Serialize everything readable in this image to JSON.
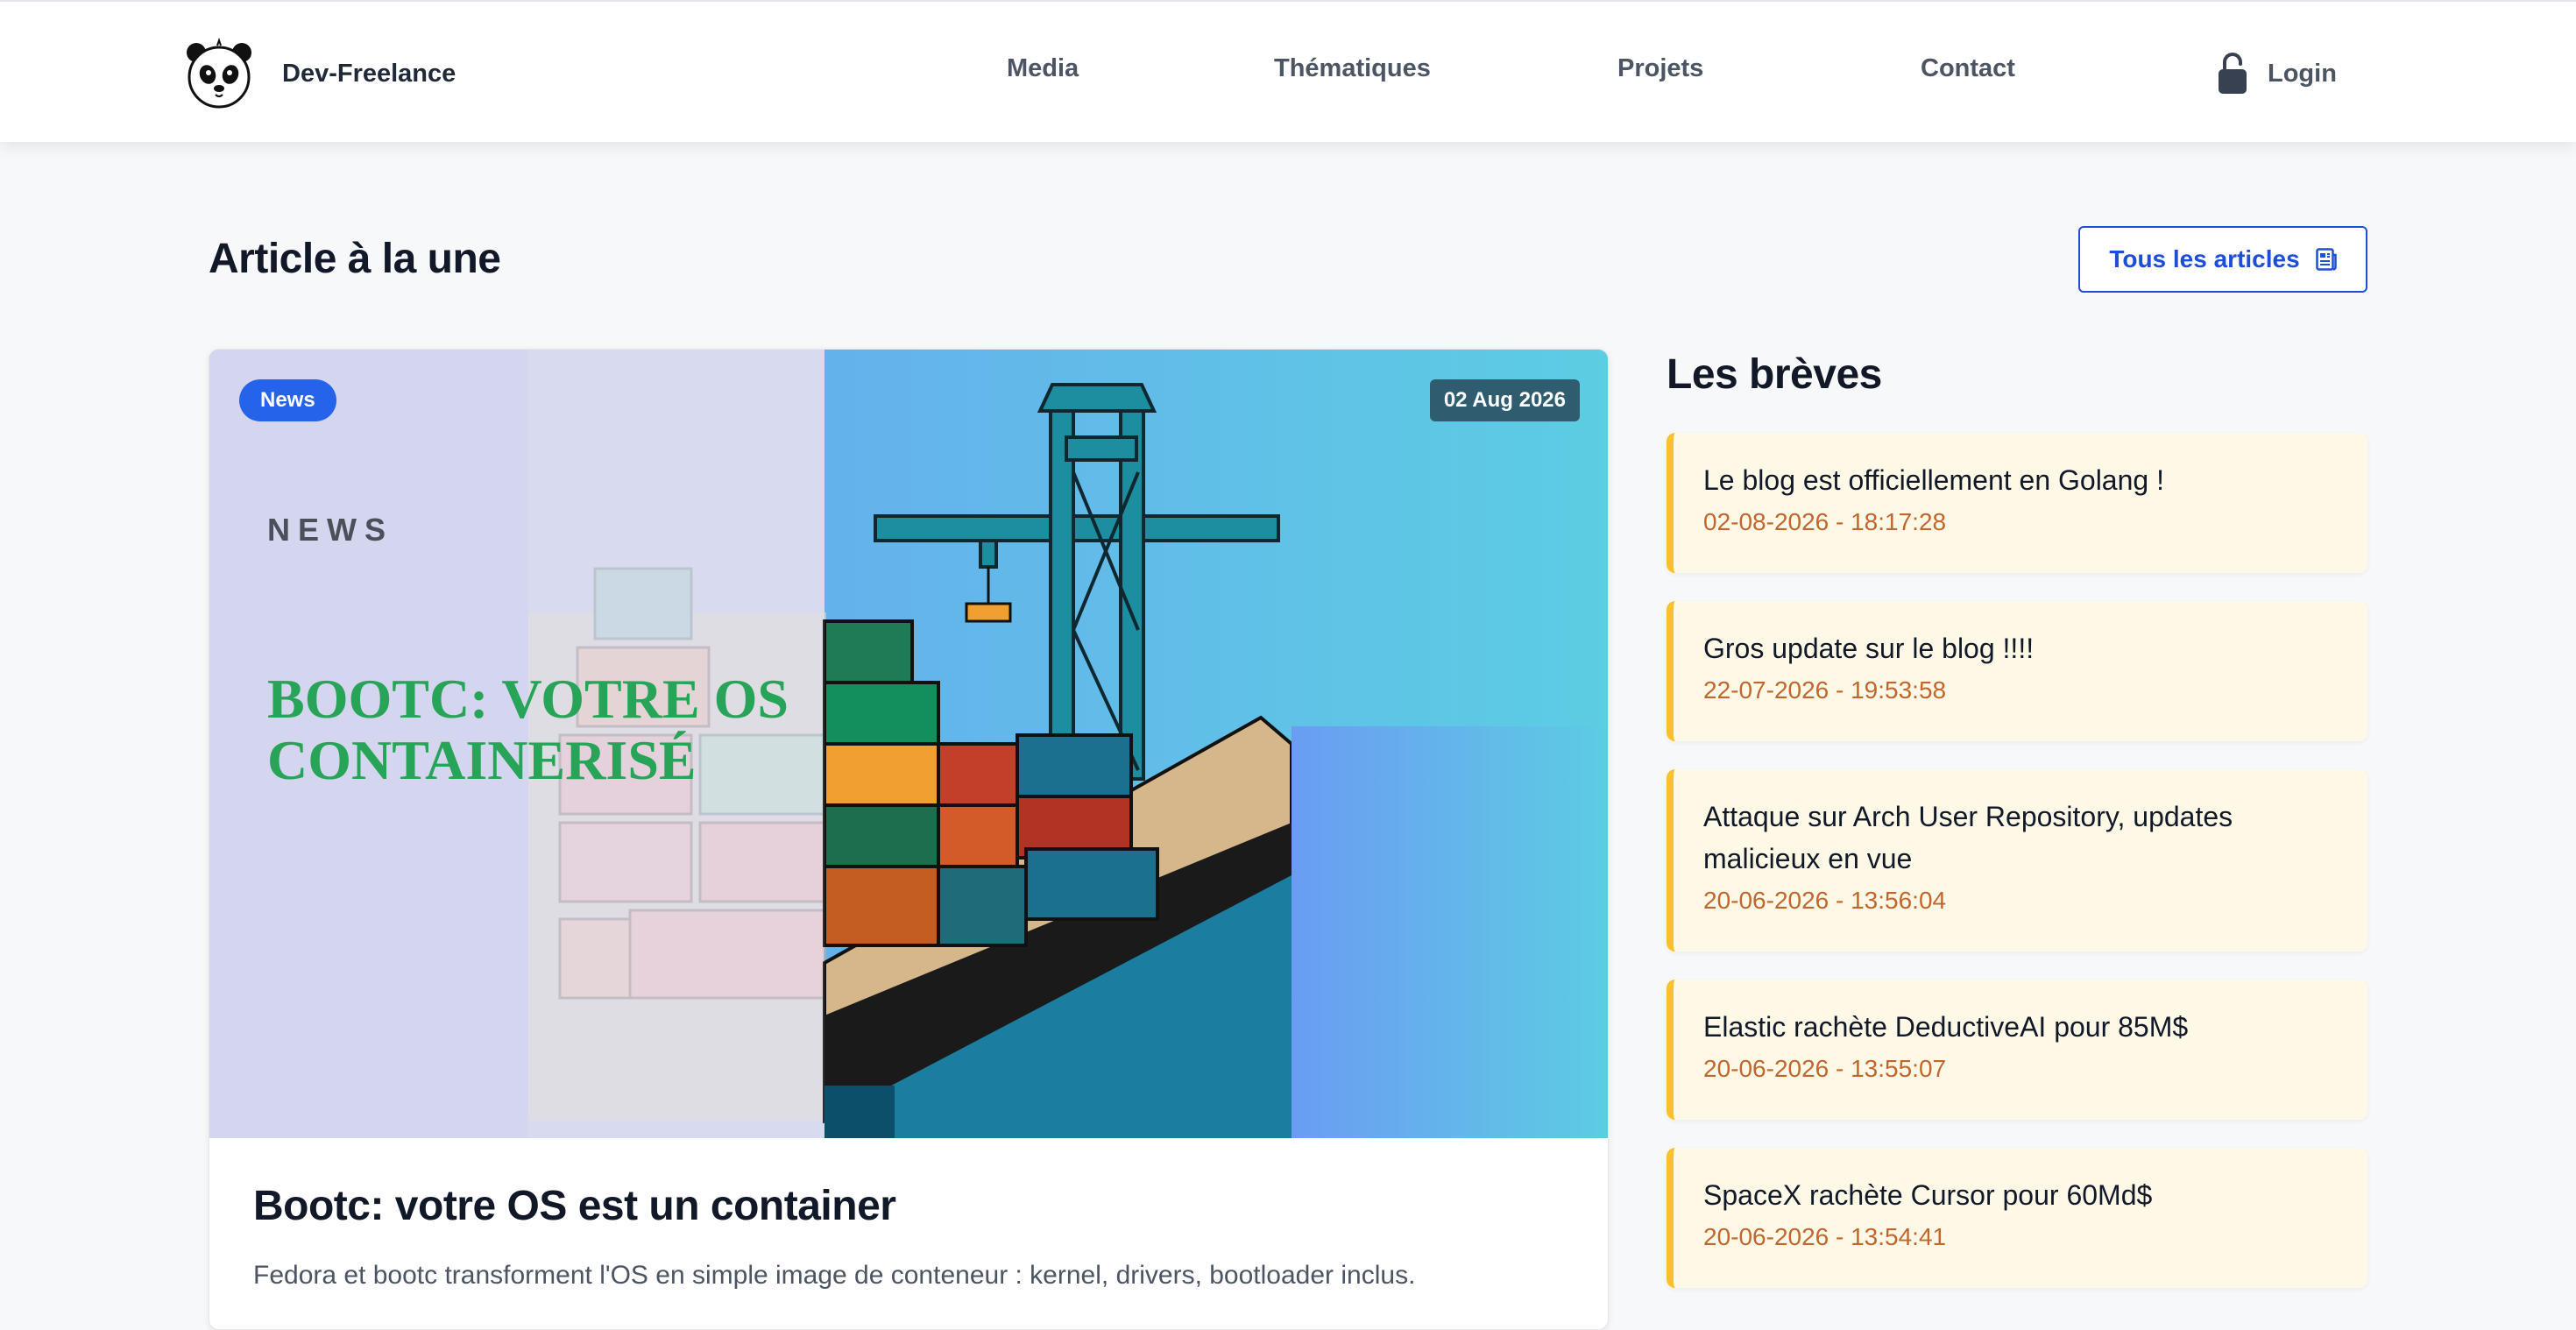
{
  "header": {
    "brand_name": "Dev-Freelance",
    "nav": [
      {
        "label": "Media"
      },
      {
        "label": "Thématiques"
      },
      {
        "label": "Projets"
      },
      {
        "label": "Contact"
      }
    ],
    "login_label": "Login",
    "icons": {
      "logo": "panda-logo",
      "login": "unlock-icon"
    }
  },
  "featured": {
    "section_title": "Article à la une",
    "all_articles_label": "Tous les articles",
    "all_articles_icon": "newspaper-icon",
    "category": "News",
    "date": "02 Aug 2026",
    "image_kicker": "NEWS",
    "image_headline_line1": "BOOTC: VOTRE OS",
    "image_headline_line2": "CONTAINERISÉ",
    "title": "Bootc: votre OS est un container",
    "excerpt": "Fedora et bootc transforment l'OS en simple image de conteneur : kernel, drivers, bootloader inclus."
  },
  "breves": {
    "title": "Les brèves",
    "items": [
      {
        "title": "Le blog est officiellement en Golang !",
        "date": "02-08-2026 - 18:17:28"
      },
      {
        "title": "Gros update sur le blog !!!!",
        "date": "22-07-2026 - 19:53:58"
      },
      {
        "title": "Attaque sur Arch User Repository, updates malicieux en vue",
        "date": "20-06-2026 - 13:56:04"
      },
      {
        "title": "Elastic rachète DeductiveAI pour 85M$",
        "date": "20-06-2026 - 13:55:07"
      },
      {
        "title": "SpaceX rachète Cursor pour 60Md$",
        "date": "20-06-2026 - 13:54:41"
      }
    ]
  },
  "colors": {
    "accent": "#1d4ed8",
    "badge": "#2563eb",
    "breve_bg": "#fef9e7",
    "breve_border": "#f6c12c",
    "breve_date": "#c2662c"
  }
}
